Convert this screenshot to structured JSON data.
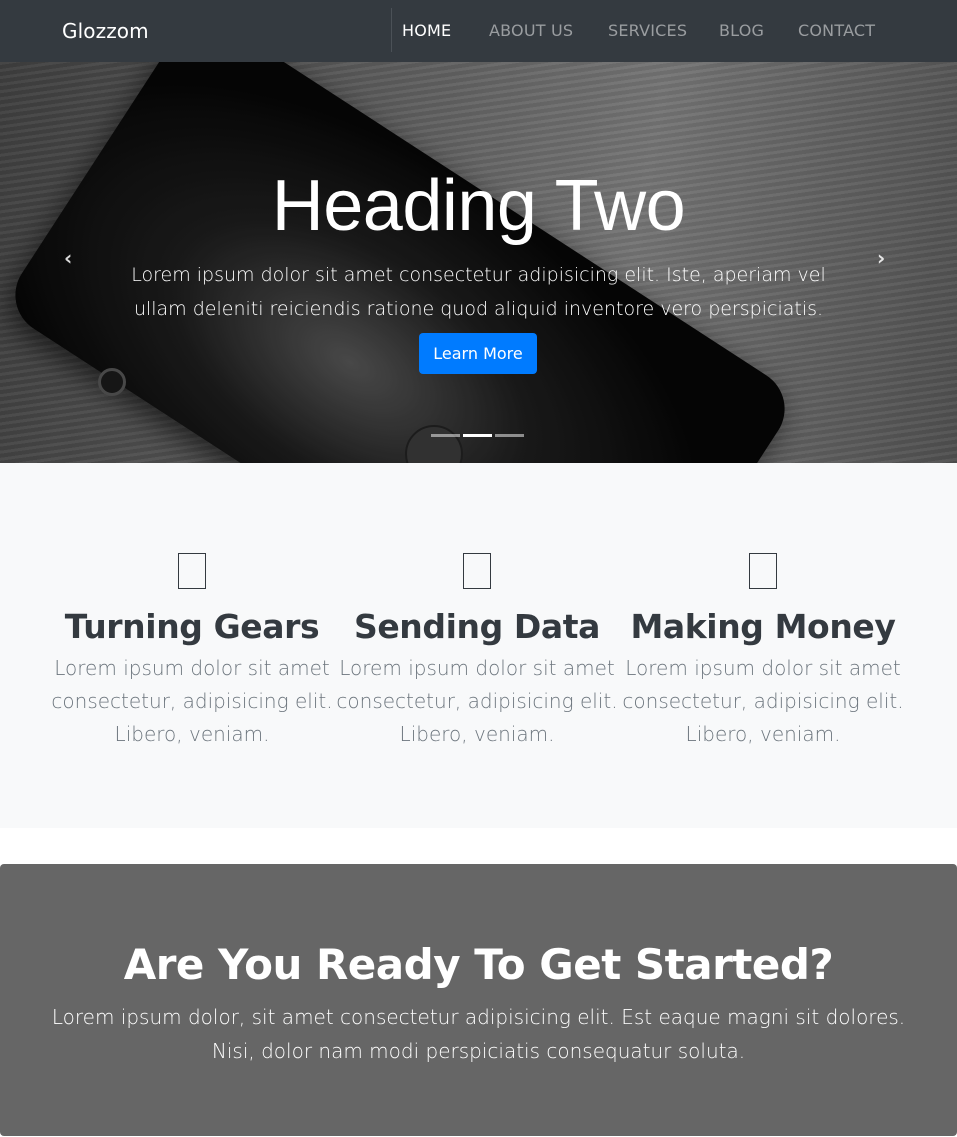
{
  "navbar": {
    "brand": "Glozzom",
    "links": [
      {
        "label": "HOME",
        "active": true
      },
      {
        "label": "ABOUT US",
        "active": false
      },
      {
        "label": "SERVICES",
        "active": false
      },
      {
        "label": "BLOG",
        "active": false
      },
      {
        "label": "CONTACT",
        "active": false
      }
    ]
  },
  "hero": {
    "heading": "Heading Two",
    "text": "Lorem ipsum dolor sit amet consectetur adipisicing elit. Iste, aperiam vel ullam deleniti reiciendis ratione quod aliquid inventore vero perspiciatis.",
    "button_label": "Learn More",
    "prev_icon": "‹",
    "next_icon": "›",
    "indicators": [
      false,
      true,
      false
    ]
  },
  "features": [
    {
      "icon": "feature-placeholder-icon",
      "title": "Turning Gears",
      "text": "Lorem ipsum dolor sit amet consectetur, adipisicing elit. Libero, veniam."
    },
    {
      "icon": "feature-placeholder-icon",
      "title": "Sending Data",
      "text": "Lorem ipsum dolor sit amet consectetur, adipisicing elit. Libero, veniam."
    },
    {
      "icon": "feature-placeholder-icon",
      "title": "Making Money",
      "text": "Lorem ipsum dolor sit amet consectetur, adipisicing elit. Libero, veniam."
    }
  ],
  "cta": {
    "heading": "Are You Ready To Get Started?",
    "text": "Lorem ipsum dolor, sit amet consectetur adipisicing elit. Est eaque magni sit dolores. Nisi, dolor nam modi perspiciatis consequatur soluta."
  },
  "colors": {
    "navbar_bg": "#343a40",
    "primary": "#007bff",
    "features_bg": "#f8f9fa",
    "cta_bg": "#666666"
  }
}
